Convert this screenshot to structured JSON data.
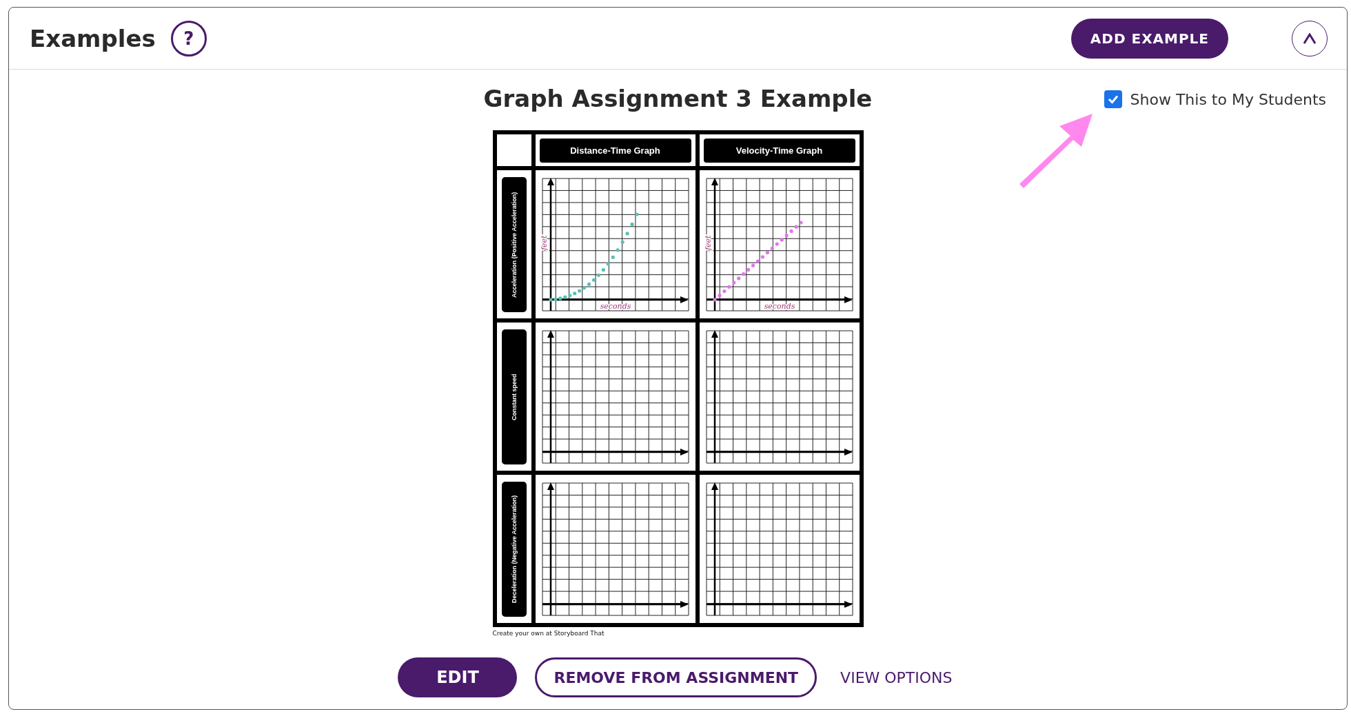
{
  "header": {
    "title": "Examples",
    "help": "?",
    "add_button": "ADD EXAMPLE"
  },
  "example": {
    "title": "Graph Assignment 3 Example",
    "show_to_students": {
      "label": "Show This to My Students",
      "checked": true
    },
    "worksheet": {
      "columns": [
        "Distance-Time Graph",
        "Velocity-Time Graph"
      ],
      "rows": [
        {
          "label": "Acceleration (Positive Acceleration)",
          "cells": [
            {
              "kind": "curve",
              "color": "#5bbfb5",
              "ylabel": "feet",
              "xlabel": "seconds"
            },
            {
              "kind": "line",
              "color": "#dd77e8",
              "ylabel": "feet",
              "xlabel": "seconds"
            }
          ]
        },
        {
          "label": "Constant speed",
          "cells": [
            {
              "kind": "empty"
            },
            {
              "kind": "empty"
            }
          ]
        },
        {
          "label": "Deceleration (Negative Acceleration)",
          "cells": [
            {
              "kind": "empty"
            },
            {
              "kind": "empty"
            }
          ]
        }
      ],
      "credit": "Create your own at Storyboard That"
    }
  },
  "actions": {
    "edit": "EDIT",
    "remove": "REMOVE FROM ASSIGNMENT",
    "view_options": "VIEW OPTIONS"
  }
}
